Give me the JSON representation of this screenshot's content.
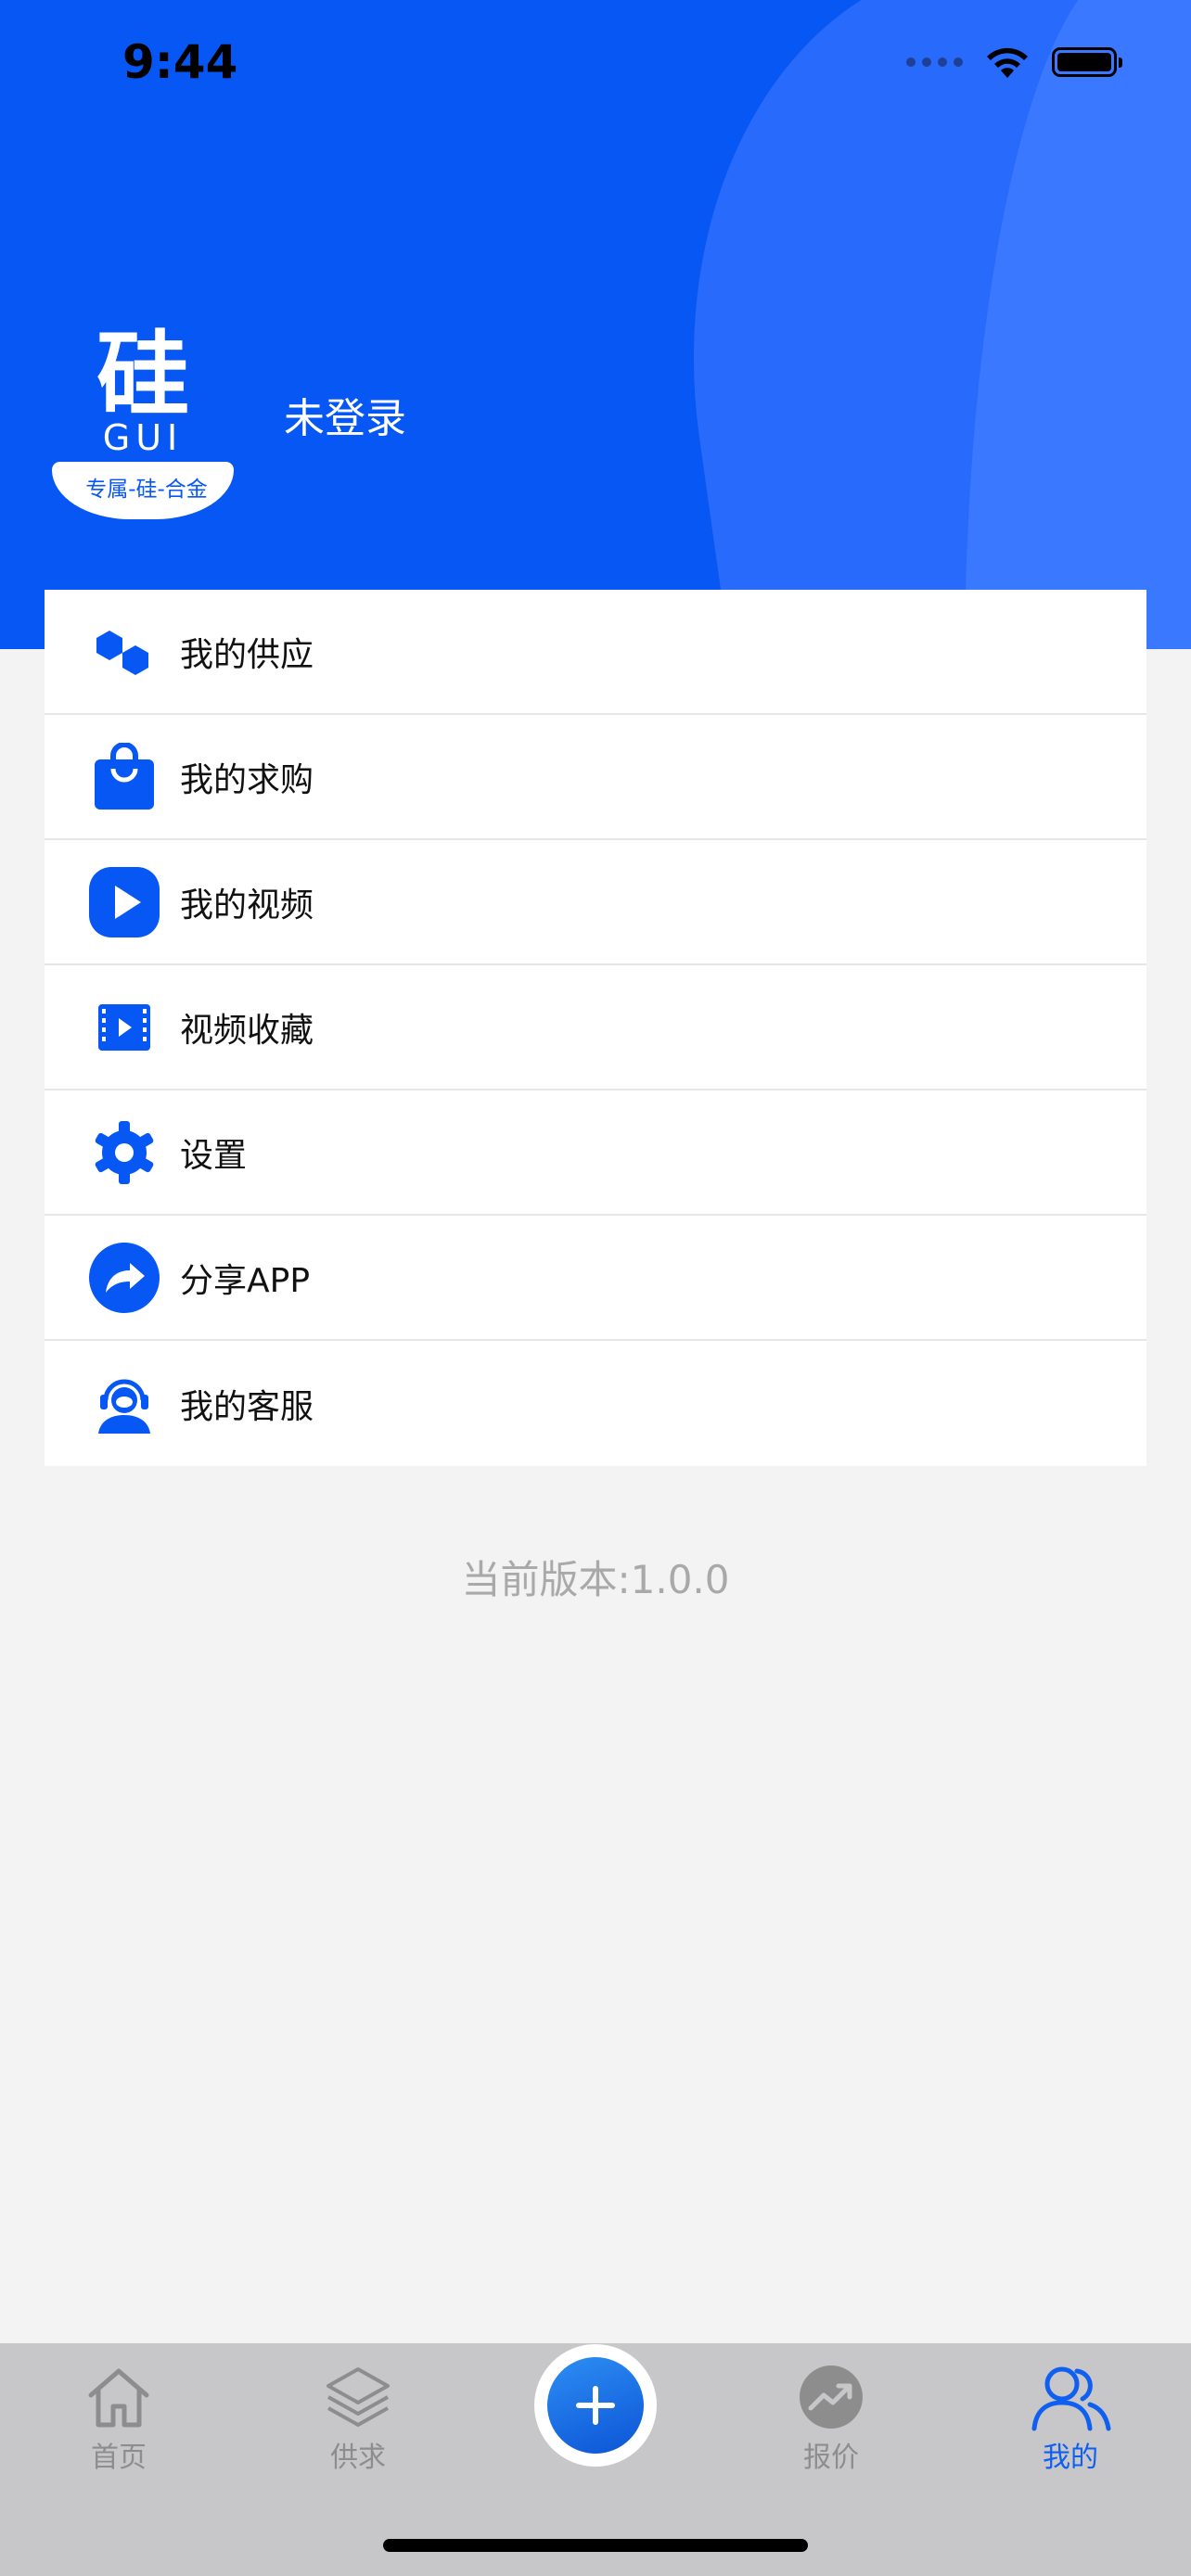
{
  "status_bar": {
    "time": "9:44"
  },
  "header": {
    "logo": {
      "char": "硅",
      "latin": "GUI",
      "slogan": "专属-硅-合金"
    },
    "login_status": "未登录"
  },
  "menu": [
    {
      "label": "我的供应",
      "icon": "hexagons-icon"
    },
    {
      "label": "我的求购",
      "icon": "shopping-bag-icon"
    },
    {
      "label": "我的视频",
      "icon": "play-icon"
    },
    {
      "label": "视频收藏",
      "icon": "film-icon"
    },
    {
      "label": "设置",
      "icon": "gear-icon"
    },
    {
      "label": "分享APP",
      "icon": "share-icon"
    },
    {
      "label": "我的客服",
      "icon": "headset-icon"
    }
  ],
  "version_text": "当前版本:1.0.0",
  "tabbar": {
    "tabs": [
      {
        "label": "首页",
        "icon": "home-icon",
        "active": false
      },
      {
        "label": "供求",
        "icon": "layers-icon",
        "active": false
      },
      {
        "label": "",
        "icon": "plus-icon",
        "active": false
      },
      {
        "label": "报价",
        "icon": "trend-icon",
        "active": false
      },
      {
        "label": "我的",
        "icon": "users-icon",
        "active": true
      }
    ]
  },
  "colors": {
    "primary": "#0757f5",
    "background": "#f3f3f3",
    "tabbar": "#c7c7c9",
    "active_tab": "#0f5ff0",
    "inactive_tab": "#8d8d8d"
  }
}
